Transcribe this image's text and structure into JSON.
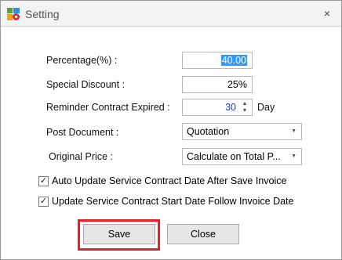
{
  "window": {
    "title": "Setting",
    "app_icon": "settings-app-icon",
    "close_glyph": "×"
  },
  "form": {
    "percentage": {
      "label": "Percentage(%) :",
      "value": "40.00"
    },
    "special_discount": {
      "label": "Special Discount :",
      "value": "25%"
    },
    "reminder": {
      "label": "Reminder Contract Expired :",
      "value": "30",
      "unit": "Day"
    },
    "post_document": {
      "label": "Post Document :",
      "value": "Quotation"
    },
    "original_price": {
      "label": "Original Price :",
      "value": "Calculate on Total P..."
    }
  },
  "options": {
    "auto_update": {
      "label": "Auto Update Service Contract Date After Save Invoice",
      "checked": true
    },
    "update_start": {
      "label": "Update Service Contract Start Date Follow Invoice Date",
      "checked": true
    }
  },
  "buttons": {
    "save": "Save",
    "close": "Close"
  },
  "colors": {
    "highlight": "#e81e2a",
    "selection": "#3399ff",
    "spin_value": "#1a3fc7"
  }
}
